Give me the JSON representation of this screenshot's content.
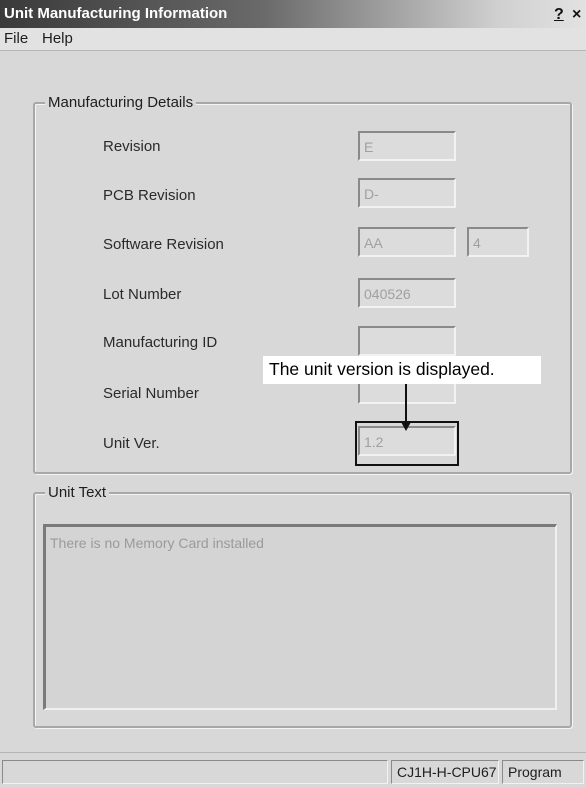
{
  "window": {
    "title": "Unit Manufacturing Information",
    "help_button": "?",
    "close_button": "×"
  },
  "menu": {
    "items": [
      "File",
      "Help"
    ]
  },
  "manufacturing_details": {
    "group_label": "Manufacturing Details",
    "fields": [
      {
        "label": "Revision",
        "value": "E"
      },
      {
        "label": "PCB Revision",
        "value": "D-"
      },
      {
        "label": "Software Revision",
        "value": "AA",
        "extra_value": "4"
      },
      {
        "label": "Lot Number",
        "value": "040526"
      },
      {
        "label": "Manufacturing ID",
        "value": ""
      },
      {
        "label": "Serial Number",
        "value": ""
      },
      {
        "label": "Unit Ver.",
        "value": "1.2"
      }
    ]
  },
  "annotation": {
    "text": "The unit version is displayed."
  },
  "unit_text": {
    "group_label": "Unit Text",
    "content": "There is no Memory Card installed"
  },
  "status_bar": {
    "empty": "",
    "model": "CJ1H-H-CPU67",
    "mode": "Program"
  }
}
